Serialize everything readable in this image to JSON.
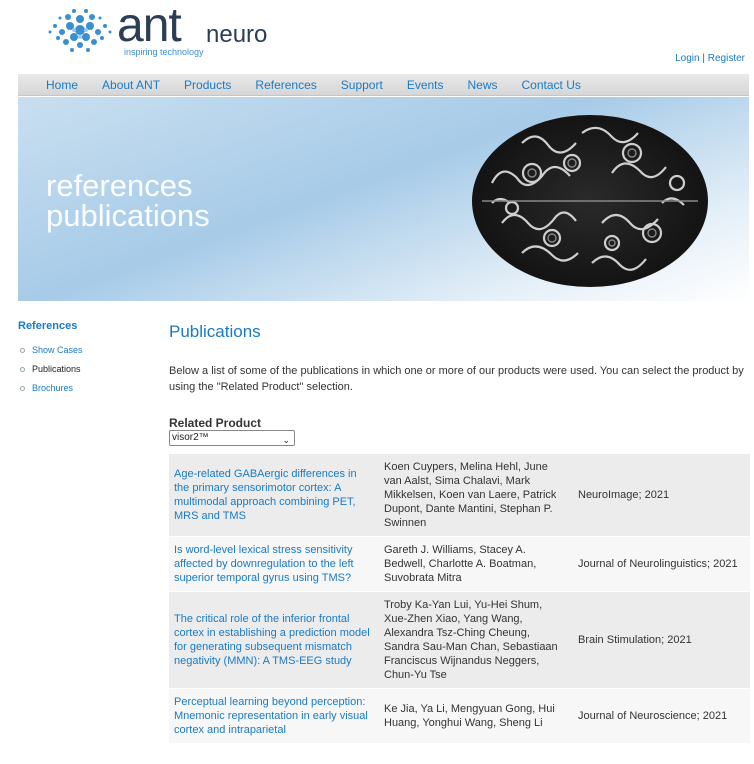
{
  "header": {
    "logo_main": "ant",
    "logo_sub": "neuro",
    "tagline": "inspiring technology",
    "login": "Login",
    "separator": "|",
    "register": "Register"
  },
  "nav": {
    "items": [
      "Home",
      "About ANT",
      "Products",
      "References",
      "Support",
      "Events",
      "News",
      "Contact Us"
    ]
  },
  "banner": {
    "line1": "references",
    "line2": "publications"
  },
  "sidebar": {
    "title": "References",
    "items": [
      "Show Cases",
      "Publications",
      "Brochures"
    ]
  },
  "main": {
    "title": "Publications",
    "intro": "Below a list of some of the publications in which one or more of our products were used. You can select the product by using the \"Related Product\" selection.",
    "related_label": "Related Product",
    "related_value": "visor2™"
  },
  "publications": [
    {
      "title": "Age-related GABAergic differences in the primary sensorimotor cortex: A multimodal approach combining PET, MRS and TMS",
      "authors": "Koen Cuypers, Melina Hehl, June van Aalst, Sima Chalavi, Mark Mikkelsen, Koen van Laere, Patrick Dupont, Dante Mantini, Stephan P. Swinnen",
      "journal": "NeuroImage; 2021"
    },
    {
      "title": "Is word-level lexical stress sensitivity affected by downregulation to the left superior temporal gyrus using TMS?",
      "authors": "Gareth J. Williams, Stacey A. Bedwell, Charlotte A. Boatman, Suvobrata Mitra",
      "journal": "Journal of Neurolinguistics; 2021"
    },
    {
      "title": "The critical role of the inferior frontal cortex in establishing a prediction model for generating subsequent mismatch negativity (MMN): A TMS-EEG study",
      "authors": "Troby Ka-Yan Lui, Yu-Hei Shum, Xue-Zhen Xiao, Yang Wang, Alexandra Tsz-Ching Cheung, Sandra Sau-Man Chan, Sebastiaan Franciscus Wijnandus Neggers, Chun-Yu Tse",
      "journal": "Brain Stimulation; 2021"
    },
    {
      "title": "Perceptual learning beyond perception: Mnemonic representation in early visual cortex and intraparietal",
      "authors": "Ke Jia, Ya Li, Mengyuan Gong, Hui Huang, Yonghui Wang, Sheng Li",
      "journal": "Journal of Neuroscience; 2021"
    }
  ]
}
